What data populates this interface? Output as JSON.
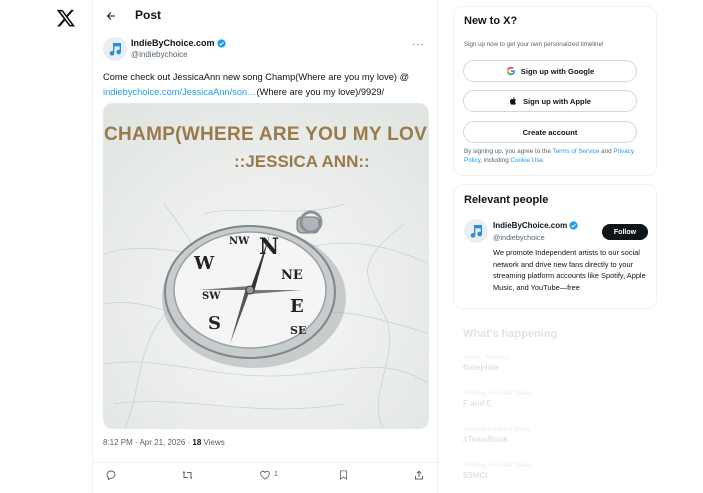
{
  "nav": {
    "logo": "x-logo-icon"
  },
  "header": {
    "title": "Post"
  },
  "tweet": {
    "author_name": "IndieByChoice.com",
    "author_handle": "@indiebychoice",
    "text_part1": "Come check out JessicaAnn new song Champ(Where are you my love) @",
    "text_link": "indiebychoice.com/JessicaAnn/son…",
    "text_part2": "(Where are you my love)/9929/",
    "media_title_line1": "CHAMP(WHERE ARE YOU MY LOVE)",
    "media_title_line2": "::JESSICA ANN::",
    "time": "8:12 PM · Apr 21, 2026 · ",
    "views_count": "18",
    "views_label": " Views",
    "likes_count": "1"
  },
  "sidebar": {
    "newx": {
      "title": "New to X?",
      "subtitle": "Sign up now to get your own personalized timeline!",
      "google_label": "Sign up with Google",
      "apple_label": "Sign up with Apple",
      "create_label": "Create account",
      "terms_pre": "By signing up, you agree to the ",
      "terms_link": "Terms of Service",
      "terms_and": " and ",
      "privacy_link": "Privacy Policy",
      "terms_mid": ", including ",
      "cookie_link": "Cookie Use",
      "terms_end": "."
    },
    "relevant": {
      "title": "Relevant people",
      "name": "IndieByChoice.com",
      "handle": "@indiebychoice",
      "follow_label": "Follow",
      "bio": "We promote Independent artists to our social network and drive new fans directly to your streaming platform accounts like Spotify, Apple Music, and YouTube—free"
    },
    "happening": {
      "title": "What's happening",
      "trends": [
        {
          "meta": "Sports · Trending",
          "name": "Nateplate"
        },
        {
          "meta": "Trending in United States",
          "name": "F and E"
        },
        {
          "meta": "Trending in United States",
          "name": "#TeamBook"
        },
        {
          "meta": "Trending in United States",
          "name": "$SMCI"
        }
      ]
    }
  },
  "colors": {
    "accent": "#1d9bf0",
    "text": "#0f1419",
    "muted": "#536471",
    "media_text": "#9a7a4a"
  }
}
